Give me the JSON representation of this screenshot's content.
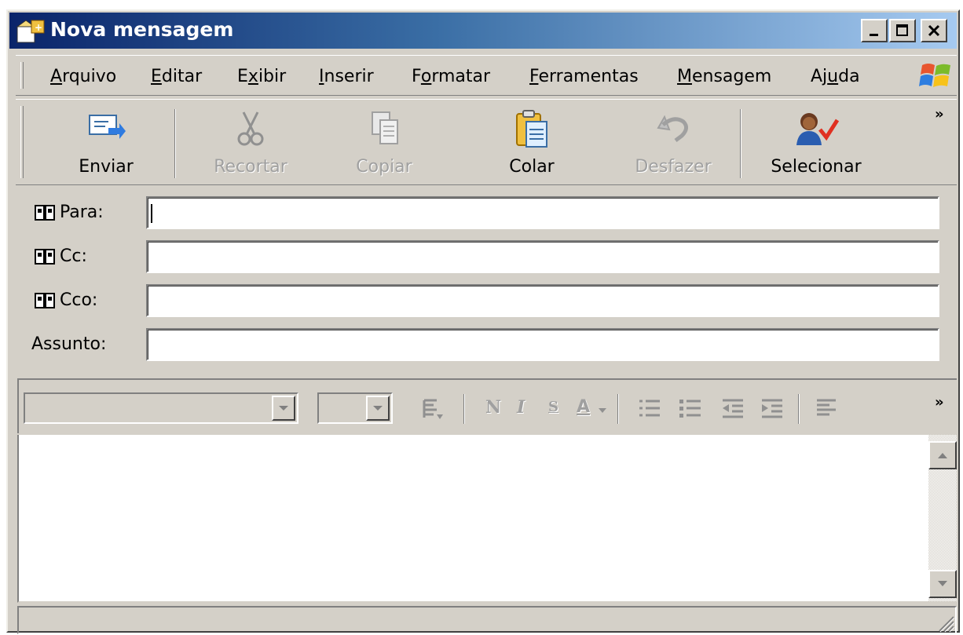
{
  "window": {
    "title": "Nova mensagem",
    "controls": {
      "minimize": "minimize",
      "maximize": "maximize",
      "close": "close"
    }
  },
  "menu": {
    "items": [
      {
        "label": "Arquivo",
        "accel": "A"
      },
      {
        "label": "Editar",
        "accel": "E"
      },
      {
        "label": "Exibir",
        "accel": "x"
      },
      {
        "label": "Inserir",
        "accel": "I"
      },
      {
        "label": "Formatar",
        "accel": "o"
      },
      {
        "label": "Ferramentas",
        "accel": "F"
      },
      {
        "label": "Mensagem",
        "accel": "M"
      },
      {
        "label": "Ajuda",
        "accel": "u"
      }
    ]
  },
  "toolbar": {
    "send": "Enviar",
    "cut": "Recortar",
    "copy": "Copiar",
    "paste": "Colar",
    "undo": "Desfazer",
    "select": "Selecionar",
    "more": "»",
    "disabled": [
      "cut",
      "copy",
      "undo"
    ]
  },
  "headers": {
    "to": {
      "label": "Para:",
      "value": ""
    },
    "cc": {
      "label": "Cc:",
      "value": ""
    },
    "bcc": {
      "label": "Cco:",
      "value": ""
    },
    "subject": {
      "label": "Assunto:",
      "value": ""
    }
  },
  "format": {
    "font_value": "",
    "size_value": "",
    "more": "»",
    "bold": "N",
    "italic": "I",
    "underline": "S",
    "color": "A"
  },
  "colors": {
    "title_gradient_start": "#0a246a",
    "title_gradient_end": "#a6caf0",
    "face": "#d4d0c8",
    "disabled_text": "#a0a0a0"
  },
  "icons": [
    "send-icon",
    "scissors-icon",
    "copy-icon",
    "paste-icon",
    "undo-icon",
    "select-recipient-icon",
    "address-book-icon",
    "windows-logo-icon"
  ]
}
